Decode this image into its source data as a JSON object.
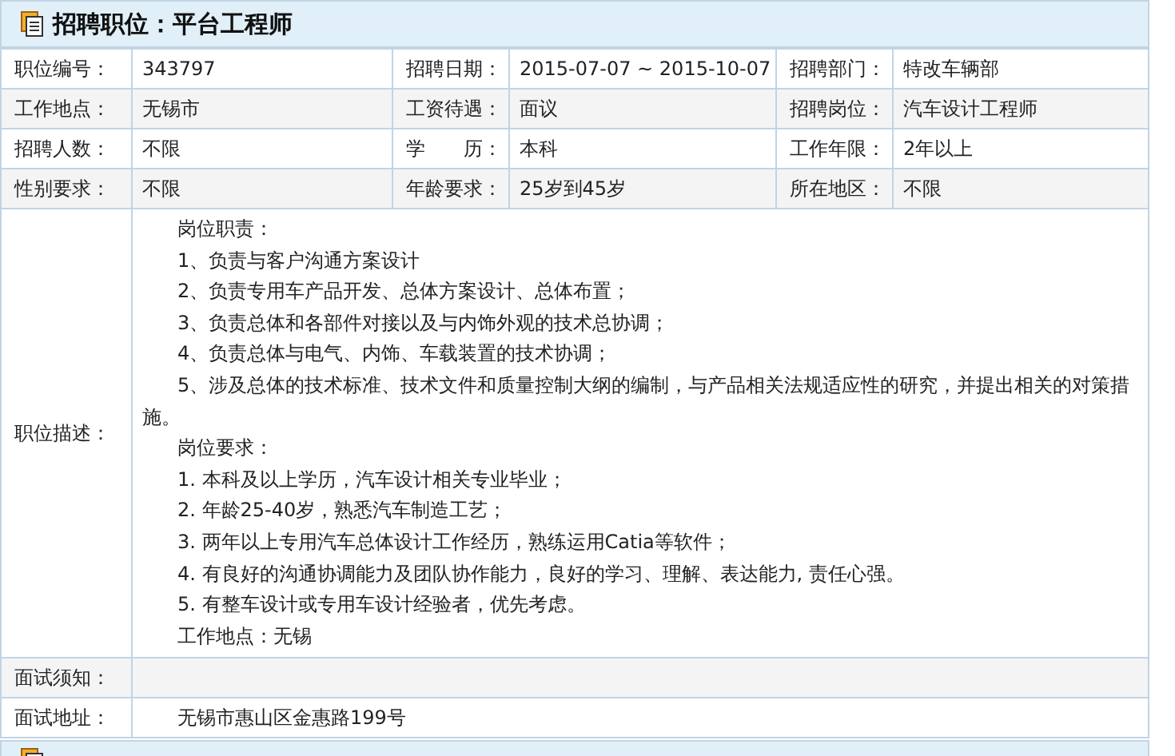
{
  "header": {
    "title": "招聘职位：平台工程师"
  },
  "fields": [
    [
      {
        "label": "职位编号：",
        "value": "343797"
      },
      {
        "label": "招聘日期：",
        "value": "2015-07-07 ~ 2015-10-07"
      },
      {
        "label": "招聘部门：",
        "value": "特改车辆部"
      }
    ],
    [
      {
        "label": "工作地点：",
        "value": "无锡市"
      },
      {
        "label": "工资待遇：",
        "value": "面议"
      },
      {
        "label": "招聘岗位：",
        "value": "汽车设计工程师"
      }
    ],
    [
      {
        "label": "招聘人数：",
        "value": "不限"
      },
      {
        "label": "学　　历：",
        "value": "本科"
      },
      {
        "label": "工作年限：",
        "value": "2年以上"
      }
    ],
    [
      {
        "label": "性别要求：",
        "value": "不限"
      },
      {
        "label": "年龄要求：",
        "value": "25岁到45岁"
      },
      {
        "label": "所在地区：",
        "value": "不限"
      }
    ]
  ],
  "description": {
    "label": "职位描述：",
    "paragraphs": [
      "岗位职责：",
      "1、负责与客户沟通方案设计",
      "2、负责专用车产品开发、总体方案设计、总体布置；",
      "3、负责总体和各部件对接以及与内饰外观的技术总协调；",
      "4、负责总体与电气、内饰、车载装置的技术协调；",
      "5、涉及总体的技术标准、技术文件和质量控制大纲的编制，与产品相关法规适应性的研究，并提出相关的对策措施。",
      "岗位要求：",
      "1. 本科及以上学历，汽车设计相关专业毕业；",
      "2. 年龄25-40岁，熟悉汽车制造工艺；",
      "3. 两年以上专用汽车总体设计工作经历，熟练运用Catia等软件；",
      "4. 有良好的沟通协调能力及团队协作能力，良好的学习、理解、表达能力, 责任心强。",
      "5. 有整车设计或专用车设计经验者，优先考虑。",
      "工作地点：无锡"
    ]
  },
  "interview_notice": {
    "label": "面试须知："
  },
  "interview_address": {
    "label": "面试地址：",
    "value": "无锡市惠山区金惠路199号"
  }
}
